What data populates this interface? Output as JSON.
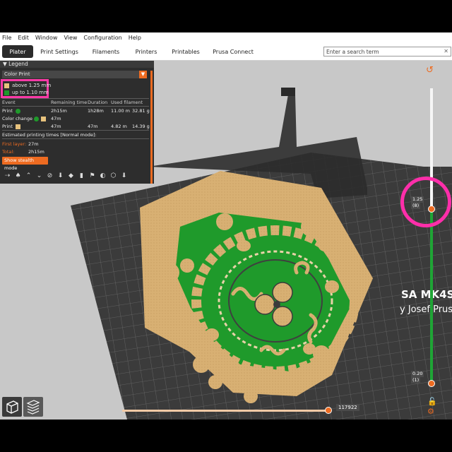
{
  "menu": [
    "File",
    "Edit",
    "Window",
    "View",
    "Configuration",
    "Help"
  ],
  "tabs": [
    "Plater",
    "Print Settings",
    "Filaments",
    "Printers",
    "Printables",
    "Prusa Connect"
  ],
  "search": {
    "placeholder": "Enter a search term"
  },
  "legend": {
    "title": "Legend",
    "mode": "Color Print",
    "ranges": [
      "above 1.25 mm",
      "up to 1.10 mm"
    ],
    "headers": [
      "Event",
      "Remaining time",
      "Duration",
      "Used filament"
    ],
    "rows": [
      {
        "event": "Print",
        "remaining": "2h15m",
        "duration": "1h28m",
        "length": "11.00 m",
        "weight": "32.81 g",
        "color": "#1f9a2b"
      },
      {
        "event": "Color change",
        "remaining": "47m",
        "duration": "",
        "length": "",
        "weight": "",
        "color": "#e7c27d"
      },
      {
        "event": "Print",
        "remaining": "47m",
        "duration": "47m",
        "length": "4.82 m",
        "weight": "14.39 g",
        "color": "#e7c27d"
      }
    ],
    "estimate_label": "Estimated printing times [Normal mode]:",
    "first_layer_label": "First layer:",
    "first_layer_value": "27m",
    "total_label": "Total:",
    "total_value": "2h15m",
    "stealth_button": "Show stealth mode"
  },
  "slider": {
    "top_value": "1.25",
    "top_layer": "(8)",
    "bottom_value": "0.20",
    "bottom_layer": "(1)",
    "horizontal_value": "117922"
  },
  "bed_text": {
    "brand_line": "SA MK4S",
    "by_line": "y Josef Prus"
  },
  "colors": {
    "accent": "#ed6b21",
    "green": "#1f9a2b",
    "tan": "#d8b073",
    "highlight": "#ff2eaa"
  }
}
